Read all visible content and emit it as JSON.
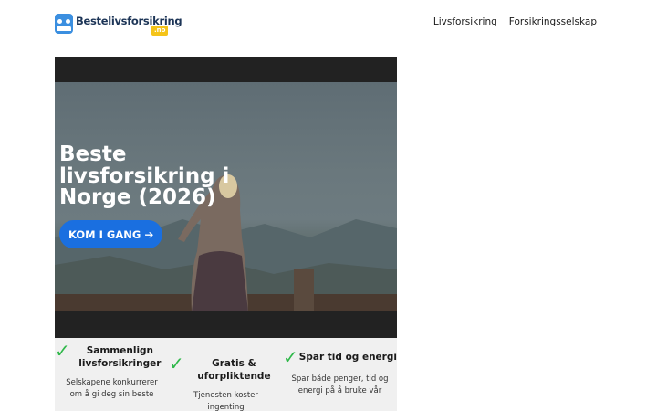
{
  "header": {
    "logo_text": "Bestelivsforsikring",
    "logo_badge": ".no",
    "nav": [
      "Livsforsikring",
      "Forsikringsselskap"
    ]
  },
  "hero": {
    "title": "Beste livsforsikring i Norge (2026)",
    "cta_label": "KOM I GANG",
    "cta_icon": "arrow-right-icon"
  },
  "features": [
    {
      "icon": "checkmark-icon",
      "title": "Sammenlign livsforsikringer",
      "description": "Selskapene konkurrerer om å gi deg sin beste"
    },
    {
      "icon": "checkmark-icon",
      "title": "Gratis & uforpliktende",
      "description": "Tjenesten koster ingenting"
    },
    {
      "icon": "checkmark-icon",
      "title": "Spar tid og energi",
      "description": "Spar både penger, tid og energi på å bruke vår"
    }
  ],
  "colors": {
    "accent": "#1a6fe0",
    "check": "#2fb84a",
    "logo_badge": "#f5c419",
    "logo_text": "#1d3557"
  }
}
